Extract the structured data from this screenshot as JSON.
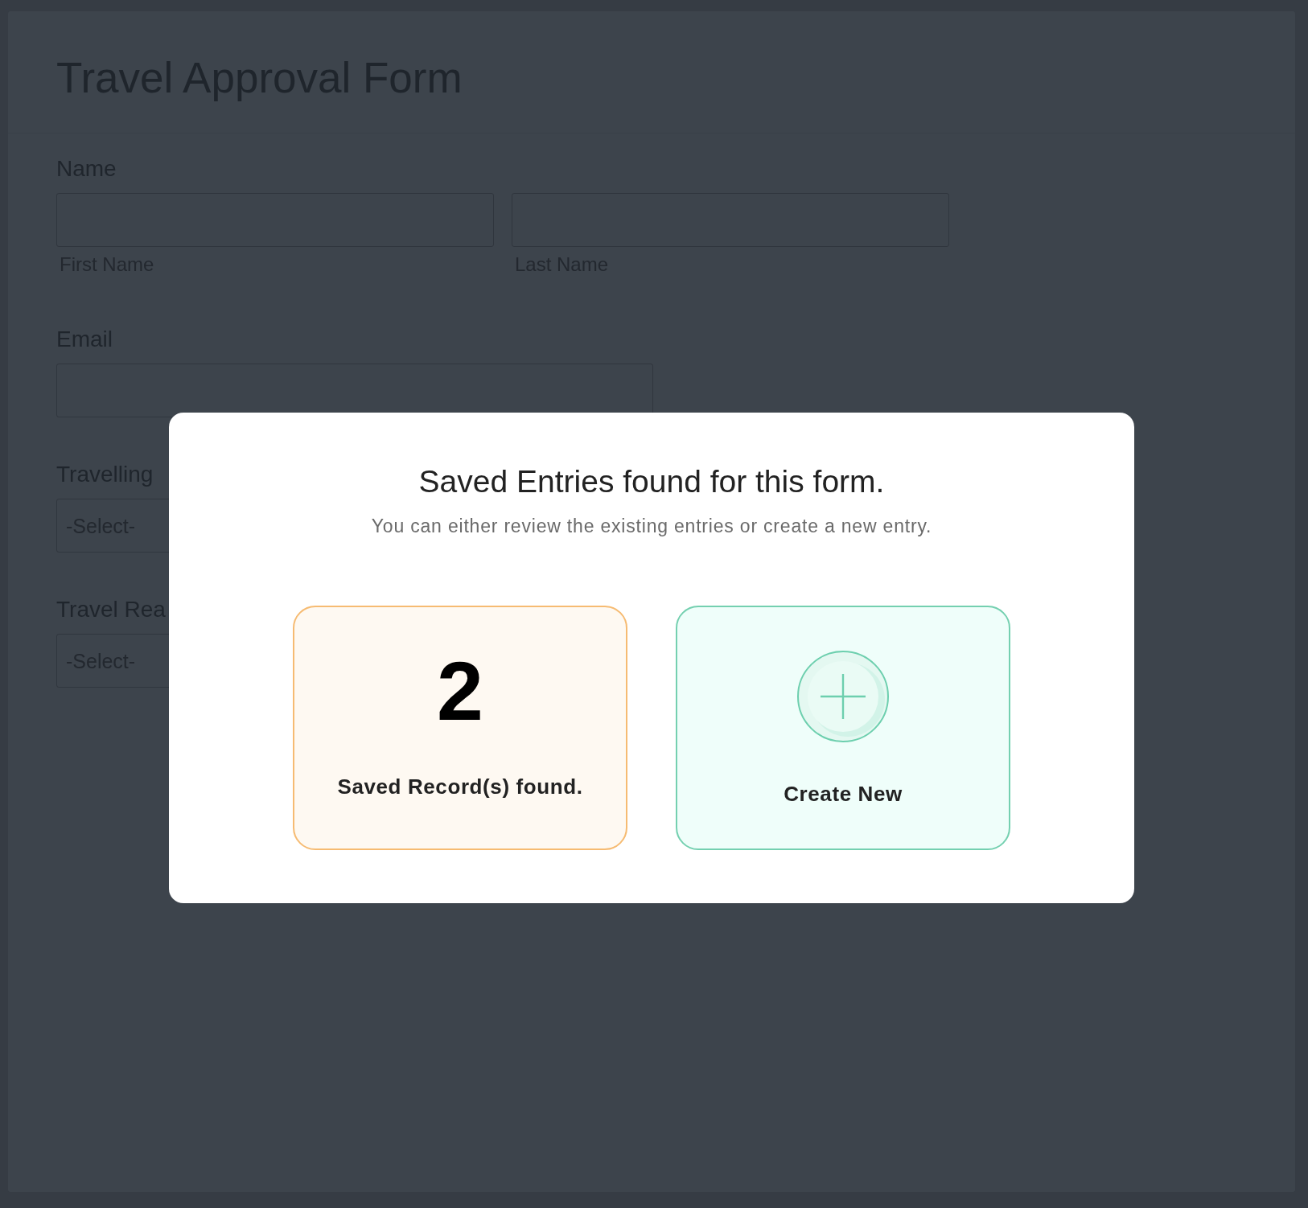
{
  "form": {
    "title": "Travel Approval Form",
    "fields": [
      {
        "kind": "name",
        "label": "Name",
        "parts": [
          {
            "sublabel": "First Name"
          },
          {
            "sublabel": "Last Name"
          }
        ]
      },
      {
        "kind": "text",
        "label": "Email"
      },
      {
        "kind": "select",
        "label": "Travelling",
        "placeholder": "-Select-"
      },
      {
        "kind": "select",
        "label": "Travel Rea",
        "placeholder": "-Select-"
      }
    ]
  },
  "dialog": {
    "title": "Saved Entries found for this form.",
    "subtitle": "You can either review the existing entries or create a new entry.",
    "options": [
      {
        "kind": "count",
        "count": "2",
        "label": "Saved Record(s) found."
      },
      {
        "kind": "create",
        "label": "Create New"
      }
    ]
  }
}
